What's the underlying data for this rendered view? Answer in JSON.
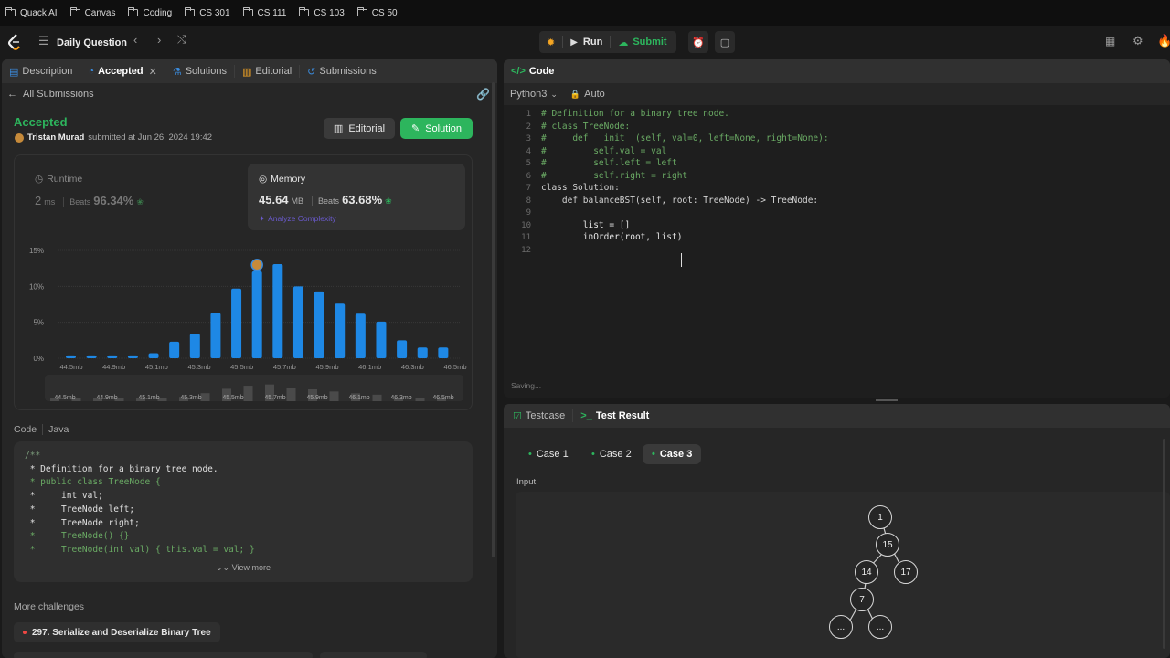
{
  "bookmarks": [
    "Quack AI",
    "Canvas",
    "Coding",
    "CS 301",
    "CS 111",
    "CS 103",
    "CS 50"
  ],
  "topbar": {
    "title": "Daily Question",
    "run": "Run",
    "submit": "Submit"
  },
  "left_tabs": [
    "Description",
    "Accepted",
    "Solutions",
    "Editorial",
    "Submissions"
  ],
  "all_submissions": "All Submissions",
  "status": {
    "label": "Accepted",
    "user": "Tristan Murad",
    "submitted": "submitted at Jun 26, 2024 19:42",
    "editorial_btn": "Editorial",
    "solution_btn": "Solution"
  },
  "runtime": {
    "label": "Runtime",
    "value": "2",
    "unit": "ms",
    "beats_label": "Beats",
    "beats": "96.34%"
  },
  "memory": {
    "label": "Memory",
    "value": "45.64",
    "unit": "MB",
    "beats_label": "Beats",
    "beats": "63.68%",
    "analyze": "Analyze Complexity"
  },
  "chart_data": {
    "type": "bar",
    "categories": [
      "44.5mb",
      "44.9mb",
      "45.1mb",
      "45.3mb",
      "45.5mb",
      "45.7mb",
      "45.9mb",
      "46.1mb",
      "46.3mb",
      "46.5mb"
    ],
    "values": [
      0.4,
      0.4,
      0.4,
      0.4,
      0.7,
      2.3,
      3.4,
      6.3,
      9.7,
      12.1,
      13.1,
      10.0,
      9.3,
      7.6,
      6.2,
      5.1,
      2.5,
      1.5,
      1.5
    ],
    "yticks": [
      "15%",
      "10%",
      "5%",
      "0%"
    ],
    "ylim": [
      0,
      15
    ],
    "color": "#1e88e5"
  },
  "code_section": {
    "label": "Code",
    "lang": "Java",
    "view_more": "View more",
    "lines": [
      "/**",
      " * Definition for a binary tree node.",
      " * public class TreeNode {",
      " *     int val;",
      " *     TreeNode left;",
      " *     TreeNode right;",
      " *     TreeNode() {}",
      " *     TreeNode(int val) { this.val = val; }"
    ]
  },
  "more_challenges": {
    "label": "More challenges",
    "item": "297. Serialize and Deserialize Binary Tree"
  },
  "editor": {
    "title": "Code",
    "language": "Python3",
    "auto": "Auto",
    "saving": "Saving...",
    "lines": [
      "# Definition for a binary tree node.",
      "# class TreeNode:",
      "#     def __init__(self, val=0, left=None, right=None):",
      "#         self.val = val",
      "#         self.left = left",
      "#         self.right = right",
      "class Solution:",
      "    def balanceBST(self, root: TreeNode) -> TreeNode:",
      "",
      "        list = []",
      "        inOrder(root, list)",
      ""
    ]
  },
  "bottom": {
    "testcase_tab": "Testcase",
    "result_tab": "Test Result",
    "cases": [
      "Case 1",
      "Case 2",
      "Case 3"
    ],
    "input_label": "Input",
    "tree": [
      "1",
      "15",
      "14",
      "17",
      "7",
      "...",
      "..."
    ]
  }
}
